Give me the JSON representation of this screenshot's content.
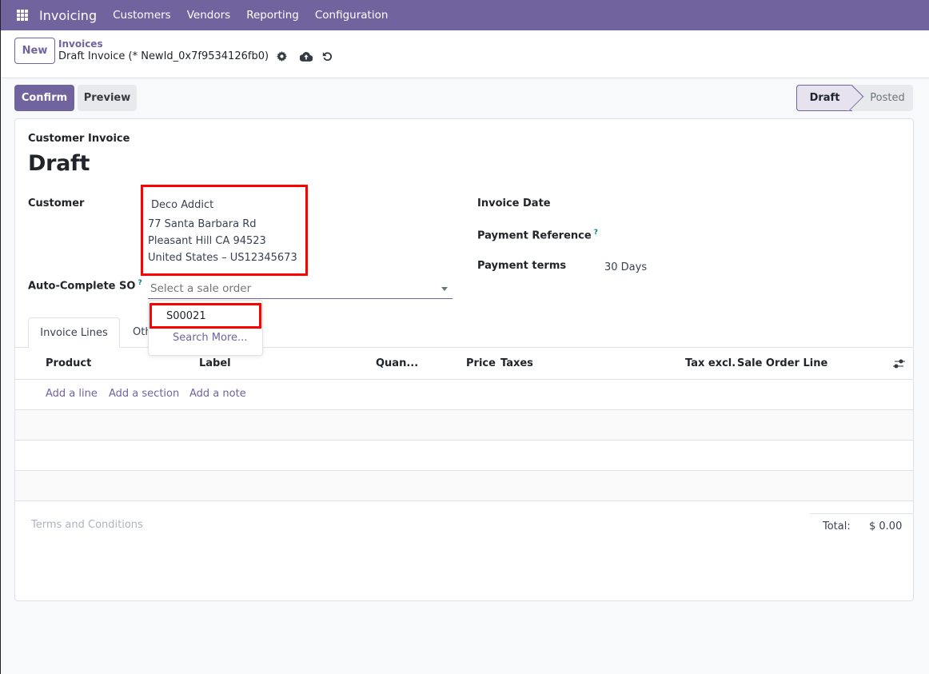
{
  "navbar": {
    "app_name": "Invoicing",
    "menu": [
      "Customers",
      "Vendors",
      "Reporting",
      "Configuration"
    ],
    "bg_color": "#71639e"
  },
  "control_panel": {
    "new_label": "New",
    "breadcrumb_parent": "Invoices",
    "breadcrumb_current": "Draft Invoice (* NewId_0x7f9534126fb0)",
    "icons": [
      "gear-icon",
      "cloud-upload-icon",
      "undo-icon"
    ]
  },
  "actions": {
    "confirm_label": "Confirm",
    "preview_label": "Preview"
  },
  "statusbar": {
    "stages": [
      "Draft",
      "Posted"
    ],
    "current": "Draft"
  },
  "form": {
    "subtitle": "Customer Invoice",
    "title": "Draft",
    "customer_label": "Customer",
    "customer": {
      "name": "Deco Addict",
      "address_lines": [
        "77 Santa Barbara Rd",
        "Pleasant Hill CA 94523",
        "United States – US12345673"
      ]
    },
    "auto_so_label": "Auto-Complete SO",
    "auto_so_help": "?",
    "auto_so_placeholder": "Select a sale order",
    "invoice_date_label": "Invoice Date",
    "payment_ref_label": "Payment Reference",
    "payment_ref_help": "?",
    "payment_terms_label": "Payment terms",
    "payment_terms_value": "30 Days"
  },
  "dropdown": {
    "items": [
      "S00021"
    ],
    "search_more": "Search More..."
  },
  "tabs": [
    "Invoice Lines",
    "Oth"
  ],
  "table": {
    "columns": [
      "Product",
      "Label",
      "Quan...",
      "Price",
      "Taxes",
      "Tax excl.",
      "Sale Order Line"
    ],
    "add_links": [
      "Add a line",
      "Add a section",
      "Add a note"
    ]
  },
  "footer": {
    "terms_placeholder": "Terms and Conditions",
    "total_label": "Total:",
    "total_value": "$ 0.00"
  },
  "highlight_color": "#ff0000"
}
